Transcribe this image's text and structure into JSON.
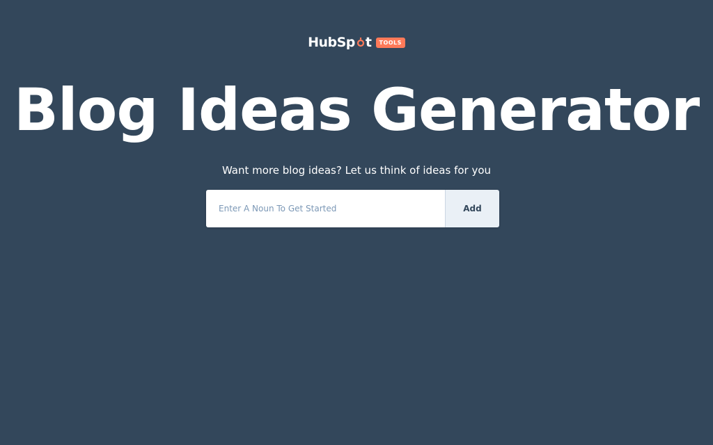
{
  "header": {
    "logo_text_before": "HubSp",
    "logo_text_after": "t",
    "badge": "TOOLS"
  },
  "main": {
    "title": "Blog Ideas Generator",
    "subtitle": "Want more blog ideas? Let us think of ideas for you",
    "input_placeholder": "Enter A Noun To Get Started",
    "input_value": "",
    "add_label": "Add"
  },
  "colors": {
    "background": "#33475b",
    "accent": "#ff7a59",
    "button_bg": "#eaf0f6"
  }
}
